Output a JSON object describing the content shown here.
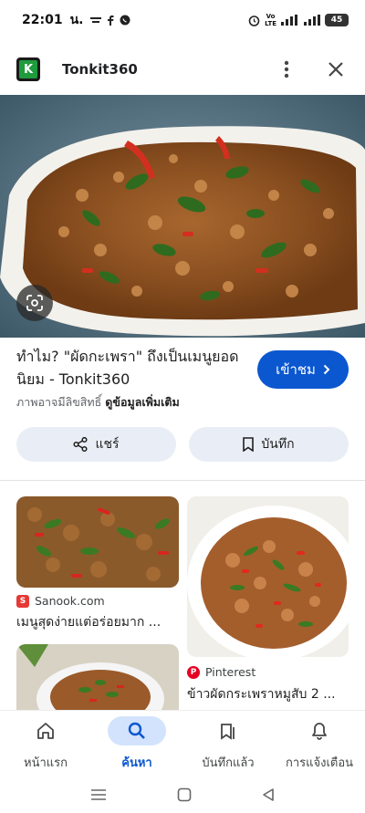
{
  "status_bar": {
    "time": "22:01",
    "ampm": "น.",
    "net_label_top": "Vo",
    "net_label_bottom": "LTE",
    "battery": "45"
  },
  "header": {
    "logo_letter": "K",
    "site_name": "Tonkit360"
  },
  "result": {
    "title": "ทำไม? \"ผัดกะเพรา\" ถึงเป็นเมนูยอดนิยม - Tonkit360",
    "visit_label": "เข้าชม",
    "disclaimer": "ภาพอาจมีลิขสิทธิ์",
    "more_label": "ดูข้อมูลเพิ่มเติม"
  },
  "actions": {
    "share_label": "แชร์",
    "save_label": "บันทึก"
  },
  "related": [
    {
      "source": "Sanook.com",
      "caption": "เมนูสุดง่ายแต่อร่อยมาก ..."
    },
    {
      "source": "Pinterest",
      "caption": "ข้าวผัดกระเพราหมูสับ 2 ..."
    }
  ],
  "bottom_nav": [
    {
      "label": "หน้าแรก",
      "icon": "home-icon"
    },
    {
      "label": "ค้นหา",
      "icon": "search-icon"
    },
    {
      "label": "บันทึกแล้ว",
      "icon": "bookmarks-icon"
    },
    {
      "label": "การแจ้งเตือน",
      "icon": "bell-icon"
    }
  ],
  "colors": {
    "accent": "#0b57d0",
    "pill_bg": "#e9eef6",
    "nav_active_bg": "#d3e3fd"
  }
}
